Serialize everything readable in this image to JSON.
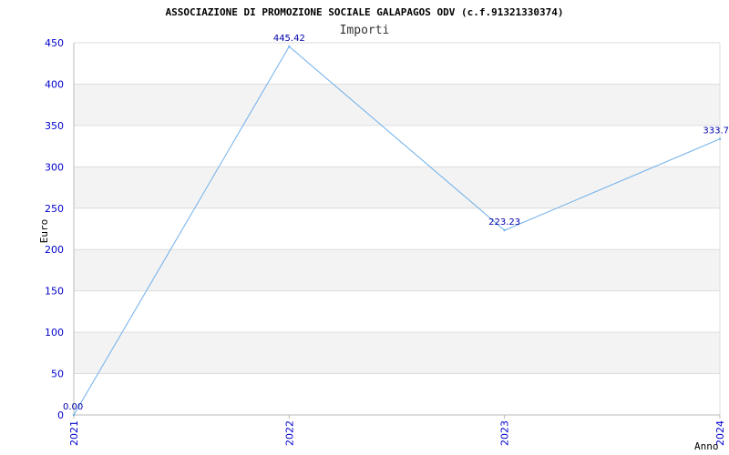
{
  "chart_data": {
    "type": "line",
    "title": "ASSOCIAZIONE DI PROMOZIONE SOCIALE GALAPAGOS ODV (c.f.91321330374)",
    "subtitle": "Importi",
    "xlabel": "Anno",
    "ylabel": "Euro",
    "categories": [
      "2021",
      "2022",
      "2023",
      "2024"
    ],
    "values": [
      0,
      445.42,
      223.23,
      333.7
    ],
    "value_labels": [
      "0.00",
      "445.42",
      "223.23",
      "333.7"
    ],
    "ylim": [
      0,
      450
    ],
    "yticks": [
      0,
      50,
      100,
      150,
      200,
      250,
      300,
      350,
      400,
      450
    ],
    "grid": "horizontal alternating bands",
    "colors": {
      "line": "#6fb0ea",
      "band": "#f3f3f3",
      "gridline": "#dddddd",
      "tick_text": "#0000cc",
      "data_label": "#0000aa"
    }
  }
}
